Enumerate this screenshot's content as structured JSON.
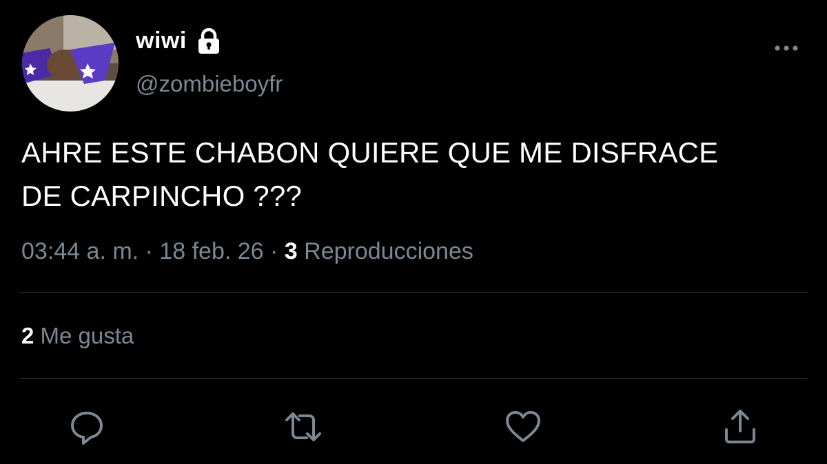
{
  "user": {
    "display_name": "wiwi",
    "handle": "@zombieboyfr",
    "protected_icon": "lock-icon",
    "avatar_icon": "avatar-photo"
  },
  "menu": {
    "icon": "more-horizontal-icon"
  },
  "tweet": {
    "text_line1": "AHRE ESTE CHABON QUIERE QUE ME DISFRACE",
    "text_line2": "DE CARPINCHO ???"
  },
  "meta": {
    "time": "03:44 a. m.",
    "separator1": " · ",
    "date": "18 feb. 26",
    "separator2": " · ",
    "views_count": "3",
    "views_label": "Reproducciones"
  },
  "stats": {
    "likes_count": "2",
    "likes_label": "Me gusta"
  },
  "actions": [
    {
      "icon": "reply-icon"
    },
    {
      "icon": "retweet-icon"
    },
    {
      "icon": "heart-icon"
    },
    {
      "icon": "share-icon"
    }
  ],
  "colors": {
    "background": "#000000",
    "text_primary": "#ffffff",
    "text_secondary": "#7c8894",
    "divider": "#2f3336"
  }
}
